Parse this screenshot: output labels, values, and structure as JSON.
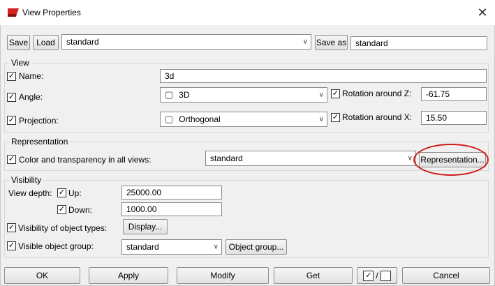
{
  "window": {
    "title": "View Properties",
    "close_glyph": "✕"
  },
  "top_row": {
    "save_label": "Save",
    "load_label": "Load",
    "preset_value": "standard",
    "save_as_label": "Save as",
    "save_as_value": "standard"
  },
  "view": {
    "group_label": "View",
    "name_label": "Name:",
    "name_value": "3d",
    "angle_label": "Angle:",
    "angle_value": "3D",
    "rot_z_label": "Rotation around Z:",
    "rot_z_value": "-61.75",
    "projection_label": "Projection:",
    "projection_value": "Orthogonal",
    "rot_x_label": "Rotation around X:",
    "rot_x_value": "15.50"
  },
  "representation": {
    "group_label": "Representation",
    "color_label": "Color and transparency in all views:",
    "color_value": "standard",
    "button_label": "Representation..."
  },
  "visibility": {
    "group_label": "Visibility",
    "view_depth_label": "View depth:",
    "up_label": "Up:",
    "up_value": "25000.00",
    "down_label": "Down:",
    "down_value": "1000.00",
    "object_types_label": "Visibility of object types:",
    "display_button": "Display...",
    "object_group_label": "Visible object group:",
    "object_group_value": "standard",
    "object_group_button": "Object group..."
  },
  "bottom": {
    "ok": "OK",
    "apply": "Apply",
    "modify": "Modify",
    "get": "Get",
    "toggle_separator": "/",
    "cancel": "Cancel"
  },
  "colors": {
    "accent_red": "#d01818",
    "icon_red": "#d42020"
  }
}
